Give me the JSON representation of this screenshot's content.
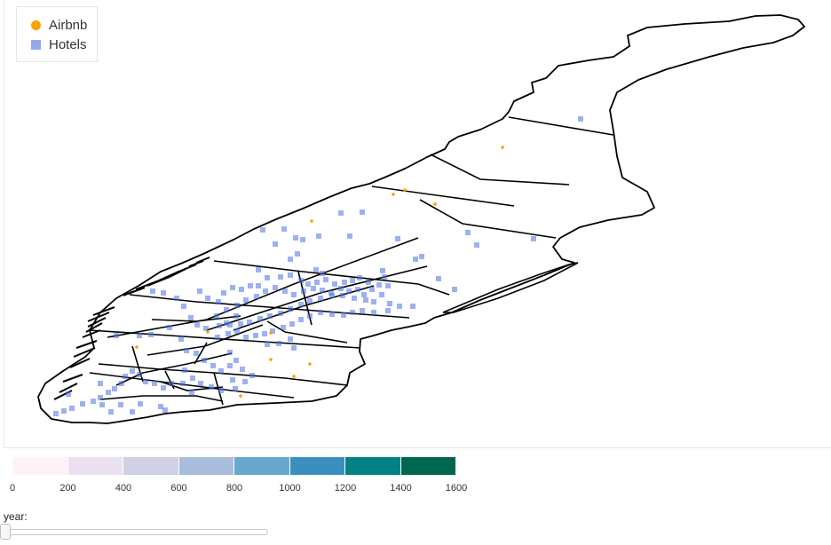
{
  "legend": {
    "airbnb_label": "Airbnb",
    "hotels_label": "Hotels",
    "airbnb_color": "#f5a300",
    "hotels_color": "#4a72e0"
  },
  "colorbar": {
    "colors": [
      "#fff1f8",
      "#ebe0ef",
      "#cfcfe5",
      "#a7bddb",
      "#67a8cf",
      "#3a8fc0",
      "#028282",
      "#016650"
    ],
    "ticks": [
      "0",
      "200",
      "400",
      "600",
      "800",
      "1000",
      "1200",
      "1400",
      "1600"
    ]
  },
  "controls": {
    "year_label": "year:"
  },
  "map": {
    "outline_color": "#000000"
  }
}
